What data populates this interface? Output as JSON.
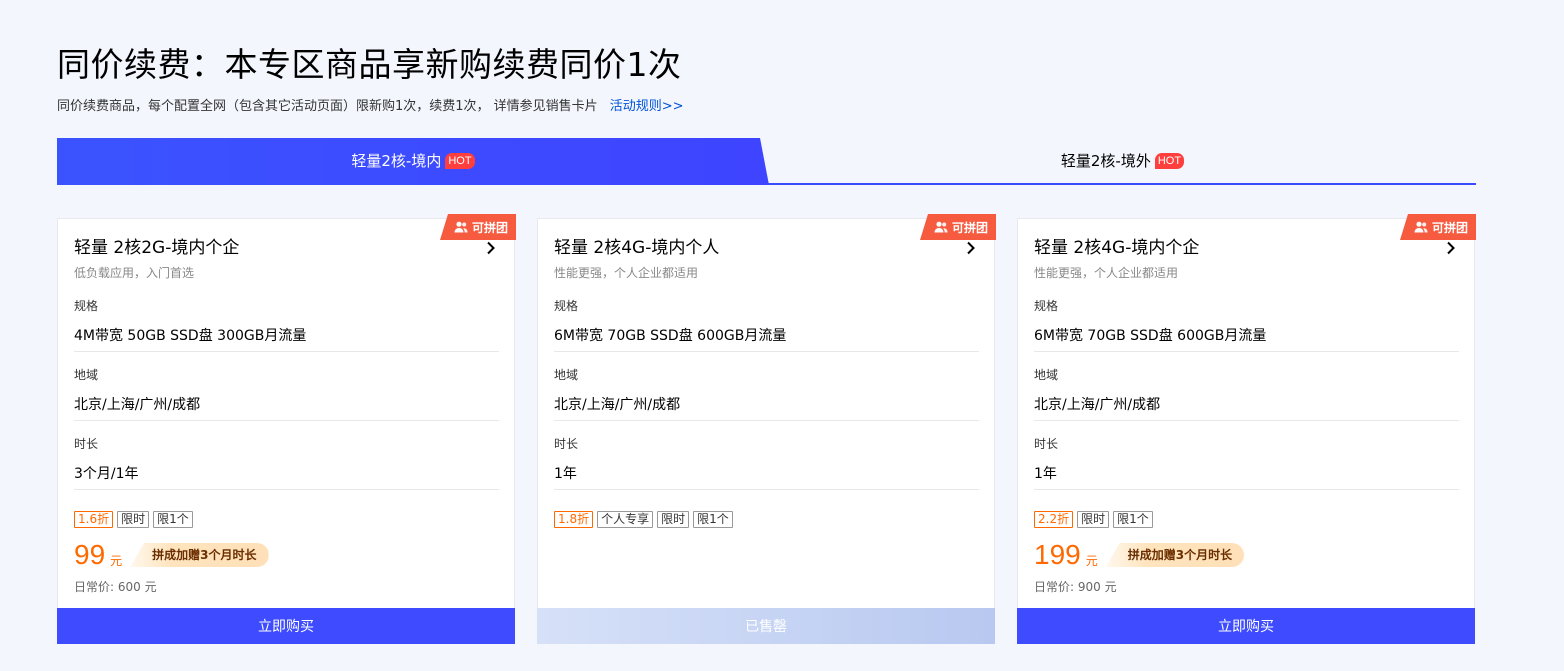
{
  "section": {
    "title": "同价续费：本专区商品享新购续费同价1次",
    "desc": "同价续费商品，每个配置全网（包含其它活动页面）限新购1次，续费1次， 详情参见销售卡片",
    "rules_link": "活动规则>>"
  },
  "tabs": [
    {
      "label": "轻量2核-境内",
      "badge": "HOT",
      "active": true
    },
    {
      "label": "轻量2核-境外",
      "badge": "HOT",
      "active": false
    }
  ],
  "cards": [
    {
      "badge": "可拼团",
      "name": "轻量 2核2G-境内个企",
      "subtitle": "低负载应用，入门首选",
      "spec_label": "规格",
      "spec_value": "4M带宽 50GB SSD盘 300GB月流量",
      "region_label": "地域",
      "region_value": "北京/上海/广州/成都",
      "duration_label": "时长",
      "duration_value": "3个月/1年",
      "tags": [
        "1.6折",
        "限时",
        "限1个"
      ],
      "price": "99",
      "unit": "元",
      "promo": "拼成加赠3个月时长",
      "regular": "日常价: 600 元",
      "button": "立即购买"
    },
    {
      "badge": "可拼团",
      "name": "轻量 2核4G-境内个人",
      "subtitle": "性能更强，个人企业都适用",
      "spec_label": "规格",
      "spec_value": "6M带宽 70GB SSD盘 600GB月流量",
      "region_label": "地域",
      "region_value": "北京/上海/广州/成都",
      "duration_label": "时长",
      "duration_value": "1年",
      "tags": [
        "1.8折",
        "个人专享",
        "限时",
        "限1个"
      ],
      "button": "已售罄"
    },
    {
      "badge": "可拼团",
      "name": "轻量 2核4G-境内个企",
      "subtitle": "性能更强，个人企业都适用",
      "spec_label": "规格",
      "spec_value": "6M带宽 70GB SSD盘 600GB月流量",
      "region_label": "地域",
      "region_value": "北京/上海/广州/成都",
      "duration_label": "时长",
      "duration_value": "1年",
      "tags": [
        "2.2折",
        "限时",
        "限1个"
      ],
      "price": "199",
      "unit": "元",
      "promo": "拼成加赠3个月时长",
      "regular": "日常价: 900 元",
      "button": "立即购买"
    }
  ]
}
